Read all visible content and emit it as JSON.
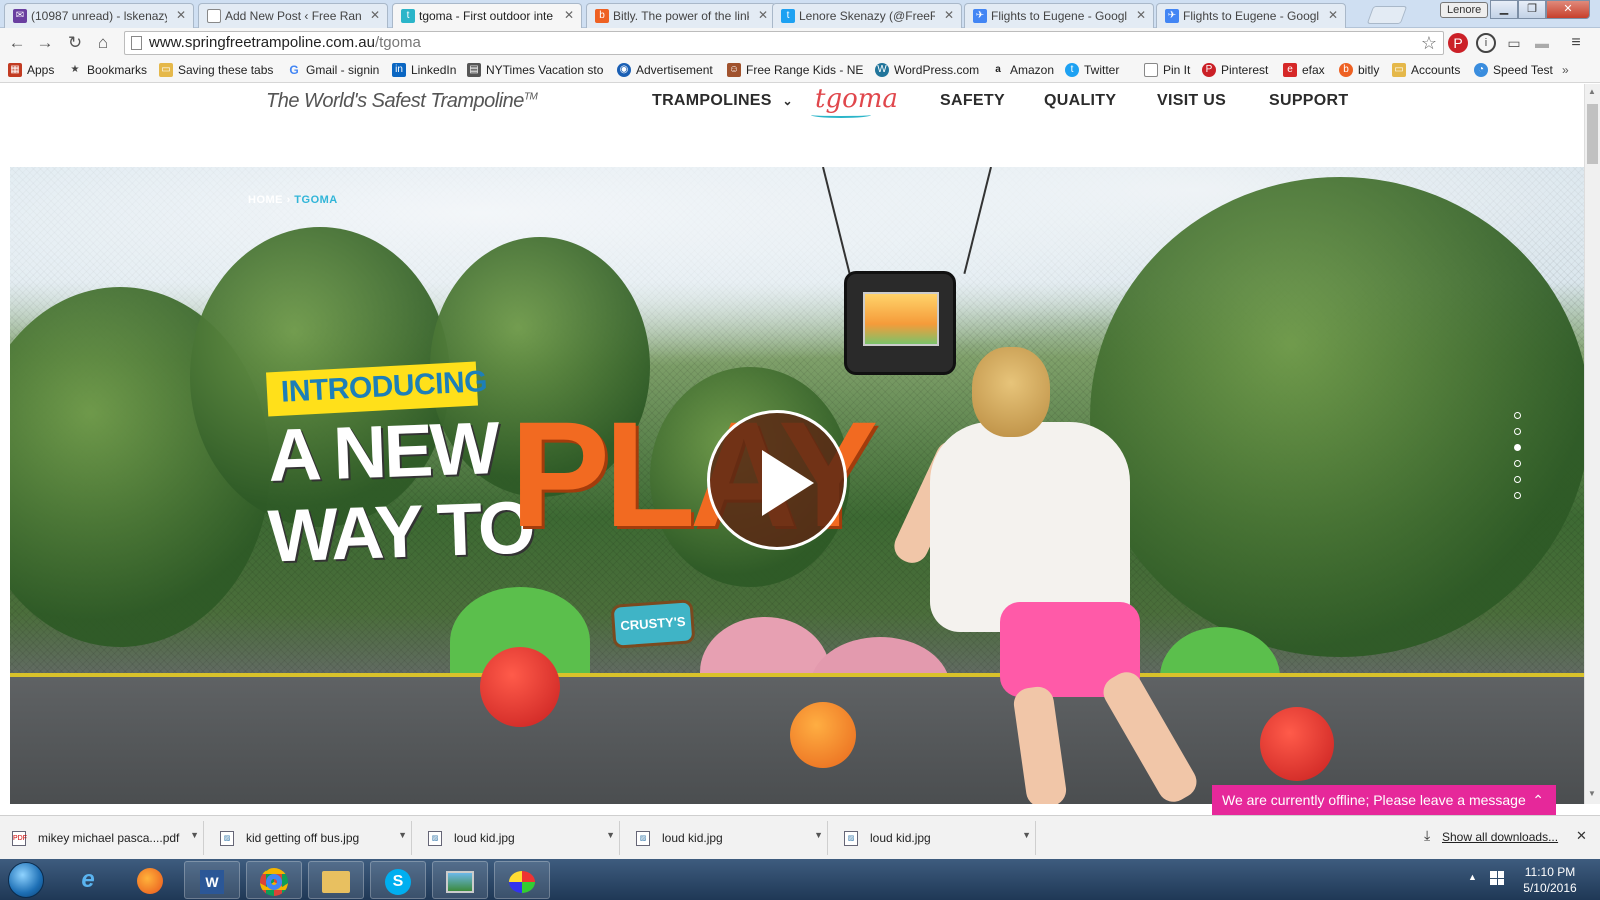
{
  "browser": {
    "tabs": [
      {
        "label": "(10987 unread) - lskenazy",
        "color": "#6a3fa0",
        "glyph": "✉"
      },
      {
        "label": "Add New Post ‹ Free Range",
        "color": "#888888",
        "glyph": "▢"
      },
      {
        "label": "tgoma - First outdoor inte",
        "color": "#2bb5c9",
        "glyph": "t"
      },
      {
        "label": "Bitly. The power of the link",
        "color": "#ee6123",
        "glyph": "b"
      },
      {
        "label": "Lenore Skenazy (@FreeRa",
        "color": "#1da1f2",
        "glyph": "🐦"
      },
      {
        "label": "Flights to Eugene - Googl",
        "color": "#4285f4",
        "glyph": "✈"
      },
      {
        "label": "Flights to Eugene - Googl",
        "color": "#4285f4",
        "glyph": "✈"
      }
    ],
    "user": "Lenore",
    "url_domain": "www.springfreetrampoline.com.au",
    "url_path": "/tgoma",
    "bookmarks": [
      {
        "label": "Apps",
        "color": "#c23b22"
      },
      {
        "label": "Bookmarks",
        "color": "#555555"
      },
      {
        "label": "Saving these tabs",
        "color": "#d9a520"
      },
      {
        "label": "Gmail - signin",
        "color": "#4285f4"
      },
      {
        "label": "LinkedIn",
        "color": "#0a66c2"
      },
      {
        "label": "NYTimes Vacation sto",
        "color": "#333333"
      },
      {
        "label": "Advertisement",
        "color": "#1a5fb4"
      },
      {
        "label": "Free Range Kids - NE",
        "color": "#a0522d"
      },
      {
        "label": "WordPress.com",
        "color": "#21759b"
      },
      {
        "label": "Amazon",
        "color": "#222222"
      },
      {
        "label": "Twitter",
        "color": "#1da1f2"
      },
      {
        "label": "Pin It",
        "color": "#777777"
      },
      {
        "label": "Pinterest",
        "color": "#cb2027"
      },
      {
        "label": "efax",
        "color": "#d62828"
      },
      {
        "label": "bitly",
        "color": "#ee6123"
      },
      {
        "label": "Accounts",
        "color": "#d9a520"
      },
      {
        "label": "Speed Test",
        "color": "#3a8dde"
      }
    ]
  },
  "site": {
    "tagline": "The World's Safest Trampoline",
    "tagline_mark": "TM",
    "nav": {
      "trampolines": "TRAMPOLINES",
      "logo": "tgoma",
      "safety": "SAFETY",
      "quality": "QUALITY",
      "visit_us": "VISIT US",
      "support": "SUPPORT"
    },
    "breadcrumb": {
      "home": "HOME",
      "sep": "›",
      "current": "TGOMA"
    },
    "hero": {
      "badge": "INTRODUCING",
      "line1": "A NEW",
      "line2": "WAY TO",
      "play": "PLAY",
      "sign": "CRUSTY'S"
    },
    "chat": "We are currently offline; Please leave a message"
  },
  "downloads": {
    "items": [
      "mikey michael pasca....pdf",
      "kid getting off bus.jpg",
      "loud kid.jpg",
      "loud kid.jpg",
      "loud kid.jpg"
    ],
    "show_all": "Show all downloads..."
  },
  "taskbar": {
    "time": "11:10 PM",
    "date": "5/10/2016"
  }
}
